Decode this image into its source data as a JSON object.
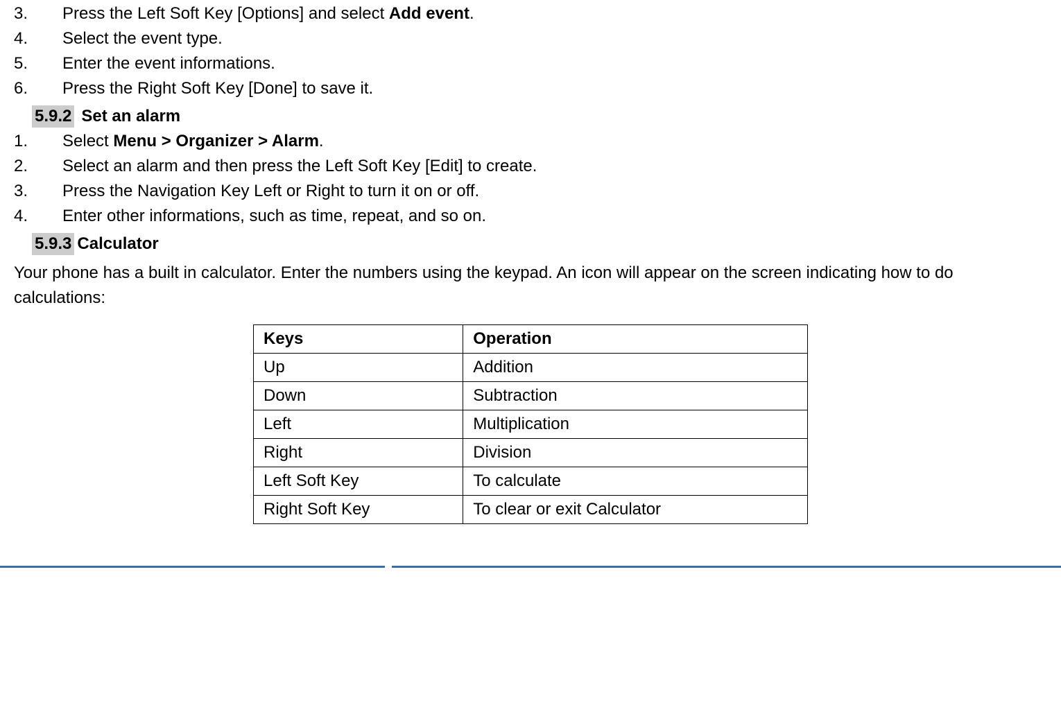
{
  "steps_top": [
    {
      "num": "3.",
      "pre": "Press the Left Soft Key [Options] and select ",
      "bold": "Add event",
      "post": "."
    },
    {
      "num": "4.",
      "pre": "Select the event type.",
      "bold": "",
      "post": ""
    },
    {
      "num": "5.",
      "pre": "Enter the event informations.",
      "bold": "",
      "post": ""
    },
    {
      "num": "6.",
      "pre": "Press the Right Soft Key [Done] to save it.",
      "bold": "",
      "post": ""
    }
  ],
  "section_592": {
    "badge": "5.9.2",
    "title": "Set an alarm"
  },
  "steps_alarm": [
    {
      "num": "1.",
      "pre": "Select ",
      "bold": "Menu > Organizer > Alarm",
      "post": "."
    },
    {
      "num": "2.",
      "pre": "Select an alarm and then press the Left Soft Key [Edit] to create.",
      "bold": "",
      "post": ""
    },
    {
      "num": "3.",
      "pre": "Press the Navigation Key Left or Right to turn it on or off.",
      "bold": "",
      "post": ""
    },
    {
      "num": "4.",
      "pre": "Enter other informations, such as time, repeat, and so on.",
      "bold": "",
      "post": ""
    }
  ],
  "section_593": {
    "badge": "5.9.3",
    "title": "Calculator"
  },
  "calculator_intro": "Your phone has a built in calculator. Enter the numbers using the keypad. An icon will appear on the screen indicating how to do calculations:",
  "calc_table": {
    "headers": {
      "col1": "Keys",
      "col2": "Operation"
    },
    "rows": [
      {
        "key": "Up",
        "op": "Addition"
      },
      {
        "key": "Down",
        "op": "Subtraction"
      },
      {
        "key": "Left",
        "op": "Multiplication"
      },
      {
        "key": "Right",
        "op": "Division"
      },
      {
        "key": "Left Soft Key",
        "op": "To calculate"
      },
      {
        "key": "Right Soft Key",
        "op": "To clear or exit Calculator"
      }
    ]
  }
}
